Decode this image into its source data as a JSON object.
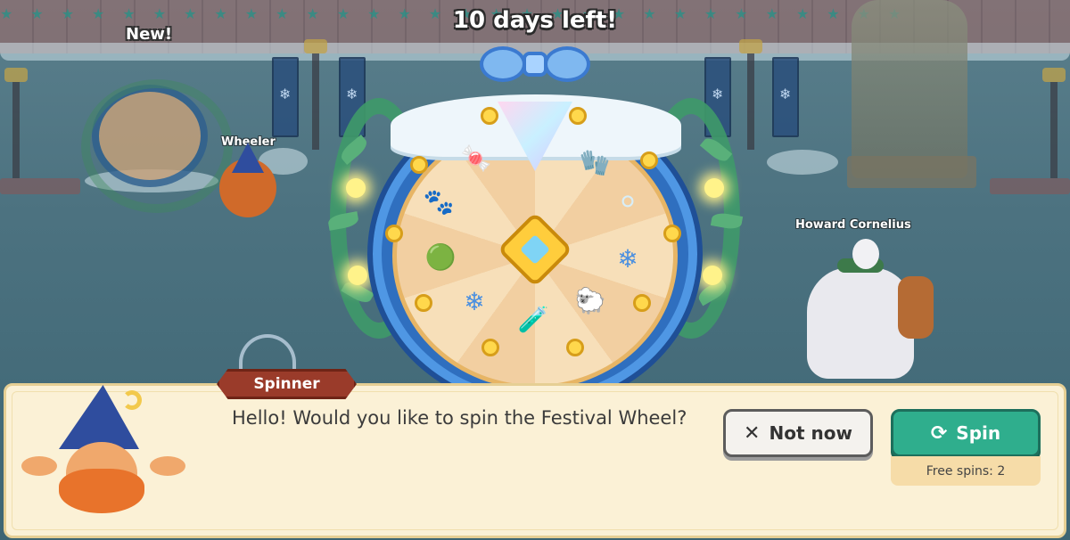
{
  "event": {
    "days_left_label": "10 days left!"
  },
  "npcs": {
    "new_label": "New!",
    "wheeler_name": "Wheeler",
    "howard_name": "Howard Cornelius"
  },
  "wheel": {
    "prizes": [
      {
        "icon": "candy-cane-icon",
        "glyph": "🍬"
      },
      {
        "icon": "mitten-icon",
        "glyph": "🧤"
      },
      {
        "icon": "snowball-icon",
        "glyph": "⚪"
      },
      {
        "icon": "snowflake-icon",
        "glyph": "❄"
      },
      {
        "icon": "snow-creature-icon",
        "glyph": "🐑"
      },
      {
        "icon": "potions-icon",
        "glyph": "🧪"
      },
      {
        "icon": "snowflake-icon",
        "glyph": "❄"
      },
      {
        "icon": "wreath-icon",
        "glyph": "🟢"
      },
      {
        "icon": "polar-creature-icon",
        "glyph": "🐾"
      }
    ]
  },
  "dialog": {
    "speaker": "Spinner",
    "message": "Hello! Would you like to spin the Festival Wheel?",
    "not_now_label": "Not now",
    "spin_label": "Spin",
    "free_spins_label": "Free spins: 2"
  },
  "colors": {
    "spin_button": "#2fae8d",
    "speaker_tag": "#9a3b2a",
    "dialog_bg": "#fbf1d6"
  }
}
